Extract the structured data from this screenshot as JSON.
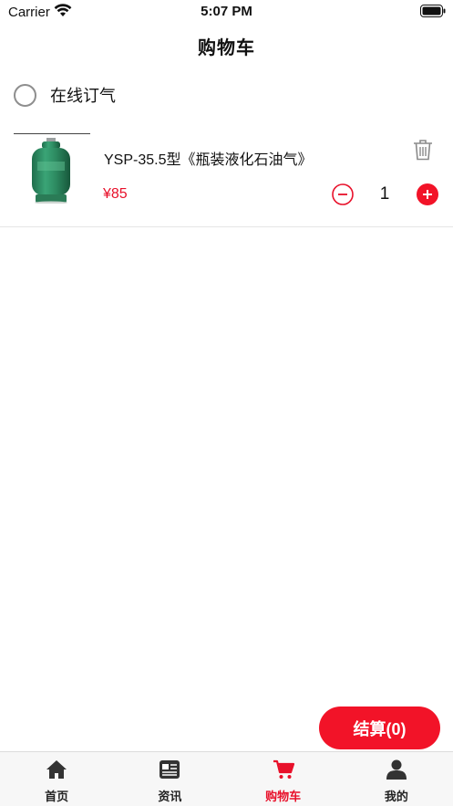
{
  "status_bar": {
    "carrier": "Carrier",
    "time": "5:07 PM"
  },
  "nav": {
    "title": "购物车"
  },
  "store": {
    "name": "在线订气",
    "selected": false
  },
  "cart_items": [
    {
      "name": "YSP-35.5型《瓶装液化石油气》",
      "price": "¥85",
      "quantity": "1",
      "image_icon": "gas-cylinder-icon"
    }
  ],
  "checkout": {
    "label": "结算(0)"
  },
  "tabs": [
    {
      "label": "首页",
      "icon": "home-icon",
      "active": false
    },
    {
      "label": "资讯",
      "icon": "news-icon",
      "active": false
    },
    {
      "label": "购物车",
      "icon": "cart-icon",
      "active": true
    },
    {
      "label": "我的",
      "icon": "user-icon",
      "active": false
    }
  ],
  "colors": {
    "accent": "#e8102a",
    "checkout_bg": "#f21328",
    "tab_icon": "#333333"
  }
}
